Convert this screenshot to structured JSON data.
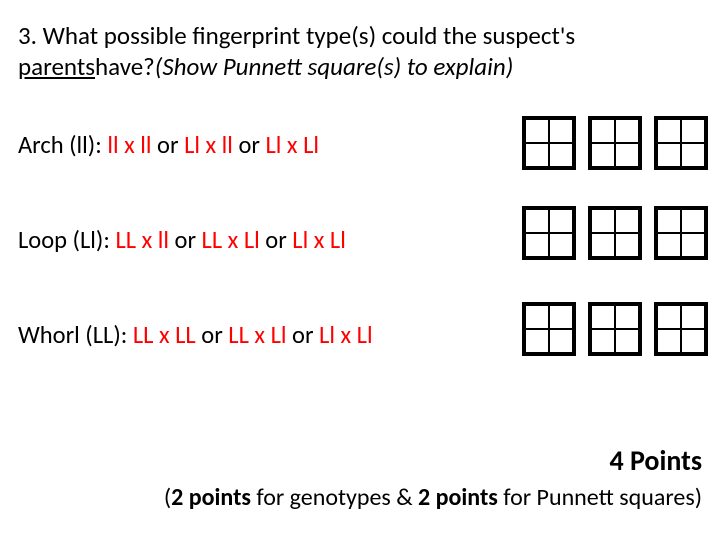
{
  "question": {
    "line1a": "3. What possible fingerprint type(s) could the suspect's",
    "line2_underline": "parents",
    "line2_plain": " have?  ",
    "line2_italic": "(Show Punnett square(s) to explain)"
  },
  "rows": {
    "arch": {
      "label": "Arch (ll):  ",
      "c1": "ll x ll",
      "or1": "   or   ",
      "c2": "Ll x ll",
      "or2": "  or  ",
      "c3": "Ll x Ll"
    },
    "loop": {
      "label": "Loop (Ll):  ",
      "c1": "LL x ll",
      "or1": "  or  ",
      "c2": "LL x Ll",
      "or2": "   or   ",
      "c3": "Ll x Ll"
    },
    "whorl": {
      "label": "Whorl (LL):  ",
      "c1": "LL x LL",
      "or1": "  or  ",
      "c2": "LL x Ll",
      "or2": "  or ",
      "c3": "Ll x Ll"
    }
  },
  "points": "4 Points",
  "rubric": {
    "open": "(",
    "b1": "2 points",
    "t1": " for genotypes & ",
    "b2": "2 points",
    "t2": " for Punnett squares)"
  }
}
